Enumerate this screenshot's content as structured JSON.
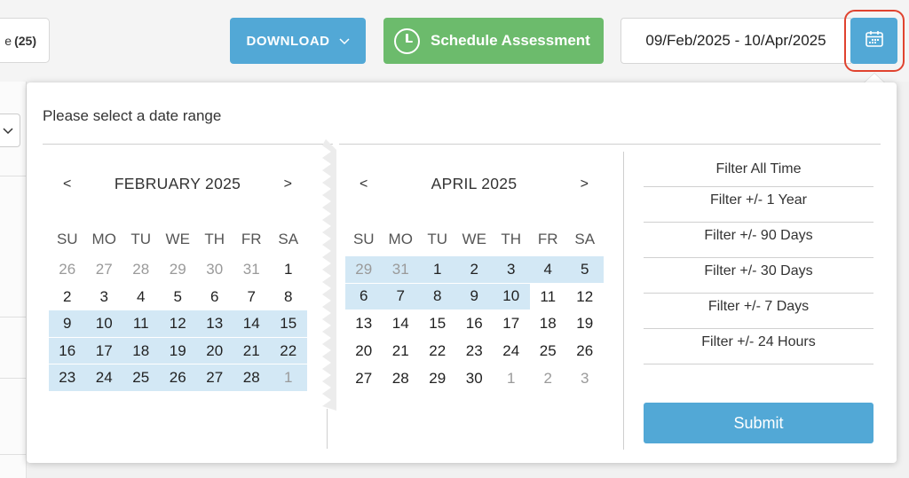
{
  "toolbar": {
    "left_button_text": "e",
    "left_button_count": "(25)",
    "download_label": "DOWNLOAD",
    "schedule_label": "Schedule Assessment",
    "date_range_value": "09/Feb/2025 - 10/Apr/2025"
  },
  "picker": {
    "title": "Please select a date range",
    "prev_symbol": "<",
    "next_symbol": ">",
    "weekdays": [
      "SU",
      "MO",
      "TU",
      "WE",
      "TH",
      "FR",
      "SA"
    ],
    "left_calendar": {
      "month_label": "FEBRUARY 2025",
      "days": [
        [
          "26",
          "27",
          "28",
          "29",
          "30",
          "31",
          "1"
        ],
        [
          "2",
          "3",
          "4",
          "5",
          "6",
          "7",
          "8"
        ],
        [
          "9",
          "10",
          "11",
          "12",
          "13",
          "14",
          "15"
        ],
        [
          "16",
          "17",
          "18",
          "19",
          "20",
          "21",
          "22"
        ],
        [
          "23",
          "24",
          "25",
          "26",
          "27",
          "28",
          "1"
        ]
      ],
      "muted": [
        [
          0,
          0
        ],
        [
          0,
          1
        ],
        [
          0,
          2
        ],
        [
          0,
          3
        ],
        [
          0,
          4
        ],
        [
          0,
          5
        ],
        [
          4,
          6
        ]
      ],
      "in_range": [
        [
          2,
          0
        ],
        [
          2,
          1
        ],
        [
          2,
          2
        ],
        [
          2,
          3
        ],
        [
          2,
          4
        ],
        [
          2,
          5
        ],
        [
          2,
          6
        ],
        [
          3,
          0
        ],
        [
          3,
          1
        ],
        [
          3,
          2
        ],
        [
          3,
          3
        ],
        [
          3,
          4
        ],
        [
          3,
          5
        ],
        [
          3,
          6
        ],
        [
          4,
          0
        ],
        [
          4,
          1
        ],
        [
          4,
          2
        ],
        [
          4,
          3
        ],
        [
          4,
          4
        ],
        [
          4,
          5
        ],
        [
          4,
          6
        ]
      ]
    },
    "right_calendar": {
      "month_label": "APRIL 2025",
      "days": [
        [
          "29",
          "31",
          "1",
          "2",
          "3",
          "4",
          "5"
        ],
        [
          "6",
          "7",
          "8",
          "9",
          "10",
          "11",
          "12"
        ],
        [
          "13",
          "14",
          "15",
          "16",
          "17",
          "18",
          "19"
        ],
        [
          "20",
          "21",
          "22",
          "23",
          "24",
          "25",
          "26"
        ],
        [
          "27",
          "28",
          "29",
          "30",
          "1",
          "2",
          "3"
        ]
      ],
      "muted": [
        [
          0,
          0
        ],
        [
          0,
          1
        ],
        [
          4,
          4
        ],
        [
          4,
          5
        ],
        [
          4,
          6
        ]
      ],
      "in_range": [
        [
          0,
          0
        ],
        [
          0,
          1
        ],
        [
          0,
          2
        ],
        [
          0,
          3
        ],
        [
          0,
          4
        ],
        [
          0,
          5
        ],
        [
          0,
          6
        ],
        [
          1,
          0
        ],
        [
          1,
          1
        ],
        [
          1,
          2
        ],
        [
          1,
          3
        ],
        [
          1,
          4
        ]
      ]
    },
    "quick_filters": [
      "Filter All Time",
      "Filter +/- 1 Year",
      "Filter +/- 90 Days",
      "Filter +/- 30 Days",
      "Filter +/- 7 Days",
      "Filter +/- 24 Hours"
    ],
    "submit_label": "Submit"
  },
  "colors": {
    "primary_blue": "#52a8d6",
    "green": "#6cbb6c",
    "range_highlight": "#d3e8f5",
    "focus_ring": "#e0432f"
  },
  "icons": {
    "schedule": "clock-icon",
    "calendar": "calendar-icon",
    "download_menu": "chevron-down-icon"
  }
}
